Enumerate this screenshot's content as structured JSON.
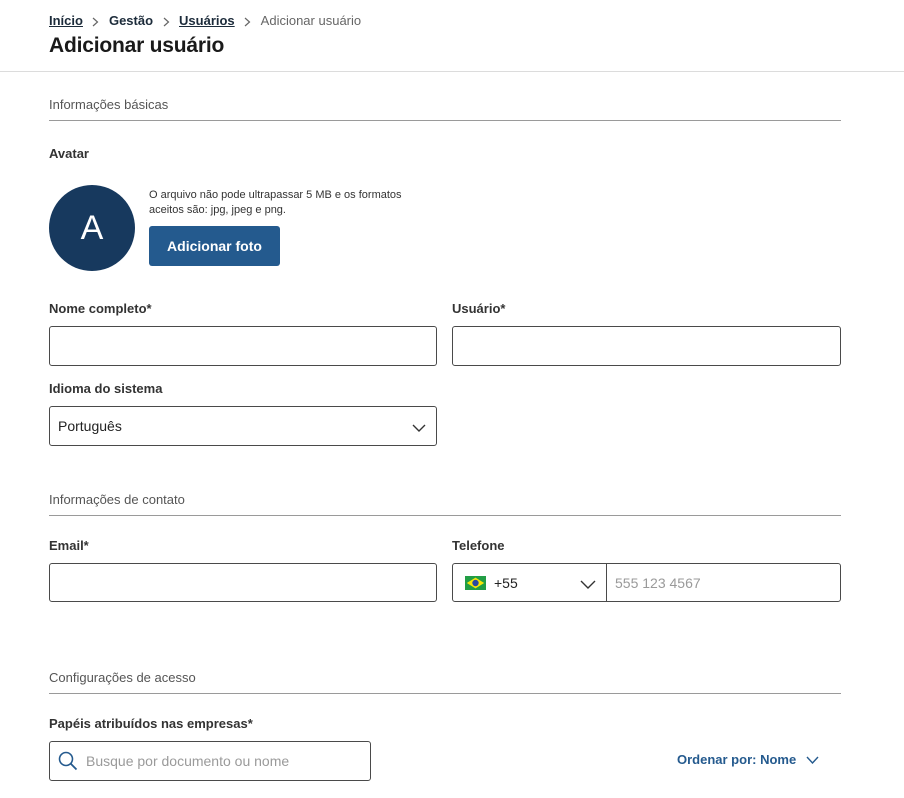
{
  "breadcrumb": {
    "items": [
      {
        "label": "Início",
        "link": true
      },
      {
        "label": "Gestão",
        "link": false
      },
      {
        "label": "Usuários",
        "link": true
      },
      {
        "label": "Adicionar usuário",
        "link": false
      }
    ]
  },
  "page": {
    "title": "Adicionar usuário"
  },
  "sections": {
    "basic": "Informações básicas",
    "contact": "Informações de contato",
    "access": "Configurações de acesso"
  },
  "avatar": {
    "label": "Avatar",
    "initial": "A",
    "hint": "O arquivo não pode ultrapassar 5 MB e os formatos aceitos são: jpg, jpeg e png.",
    "button_label": "Adicionar foto"
  },
  "form": {
    "full_name": {
      "label": "Nome completo*",
      "value": ""
    },
    "username": {
      "label": "Usuário*",
      "value": ""
    },
    "language": {
      "label": "Idioma do sistema",
      "value": "Português"
    },
    "email": {
      "label": "Email*",
      "value": ""
    },
    "phone": {
      "label": "Telefone",
      "country_code": "+55",
      "flag": "brazil-flag-icon",
      "placeholder": "555 123 4567",
      "value": ""
    },
    "roles": {
      "label": "Papéis atribuídos nas empresas*",
      "search_placeholder": "Busque por documento ou nome"
    }
  },
  "sort": {
    "label": "Ordenar por: Nome"
  },
  "colors": {
    "primary": "#245a8e",
    "avatar_bg": "#17395e",
    "text_dark": "#1c2b3a"
  }
}
